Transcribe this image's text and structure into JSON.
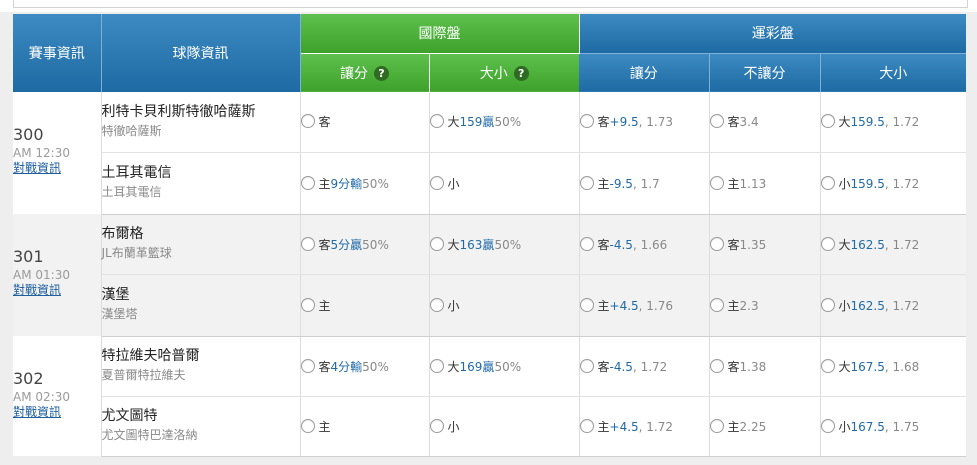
{
  "header": {
    "match_info": "賽事資訊",
    "team_info": "球隊資訊",
    "intl_market": "國際盤",
    "sports_lottery": "運彩盤",
    "intl_handicap": "讓分",
    "intl_total": "大小",
    "lottery_handicap": "讓分",
    "lottery_moneyline": "不讓分",
    "lottery_total": "大小",
    "help_symbol": "?"
  },
  "colors": {
    "intl_header": "#4cb23a",
    "lottery_header": "#2a78b4",
    "link": "#1e5fa0"
  },
  "icons": {
    "help": "question-circle-icon",
    "radio": "radio-circle"
  },
  "games": [
    {
      "number": "300",
      "time": "AM 12:30",
      "link": "對戰資訊",
      "away": {
        "name": "利特卡貝利斯特徹哈薩斯",
        "sub": "特徹哈薩斯",
        "intl_handicap": {
          "side": "客",
          "value": "",
          "result": ""
        },
        "intl_total": {
          "side": "大",
          "line": "159",
          "result": "贏",
          "pct": "50%"
        },
        "lot_handicap": {
          "side": "客",
          "line": "+9.5",
          "odds": "1.73"
        },
        "lot_ml": {
          "side": "客",
          "odds": "3.4"
        },
        "lot_total": {
          "side": "大",
          "line": "159.5",
          "odds": "1.72"
        }
      },
      "home": {
        "name": "土耳其電信",
        "sub": "土耳其電信",
        "intl_handicap": {
          "side": "主",
          "value": "9分",
          "result": "輸",
          "pct": "50%"
        },
        "intl_total": {
          "side": "小",
          "line": "",
          "result": "",
          "pct": ""
        },
        "lot_handicap": {
          "side": "主",
          "line": "-9.5",
          "odds": "1.7"
        },
        "lot_ml": {
          "side": "主",
          "odds": "1.13"
        },
        "lot_total": {
          "side": "小",
          "line": "159.5",
          "odds": "1.72"
        }
      }
    },
    {
      "number": "301",
      "time": "AM 01:30",
      "link": "對戰資訊",
      "away": {
        "name": "布爾格",
        "sub": "JL布蘭革籃球",
        "intl_handicap": {
          "side": "客",
          "value": "5分",
          "result": "贏",
          "pct": "50%"
        },
        "intl_total": {
          "side": "大",
          "line": "163",
          "result": "贏",
          "pct": "50%"
        },
        "lot_handicap": {
          "side": "客",
          "line": "-4.5",
          "odds": "1.66"
        },
        "lot_ml": {
          "side": "客",
          "odds": "1.35"
        },
        "lot_total": {
          "side": "大",
          "line": "162.5",
          "odds": "1.72"
        }
      },
      "home": {
        "name": "漢堡",
        "sub": "漢堡塔",
        "intl_handicap": {
          "side": "主",
          "value": "",
          "result": "",
          "pct": ""
        },
        "intl_total": {
          "side": "小",
          "line": "",
          "result": "",
          "pct": ""
        },
        "lot_handicap": {
          "side": "主",
          "line": "+4.5",
          "odds": "1.76"
        },
        "lot_ml": {
          "side": "主",
          "odds": "2.3"
        },
        "lot_total": {
          "side": "小",
          "line": "162.5",
          "odds": "1.72"
        }
      }
    },
    {
      "number": "302",
      "time": "AM 02:30",
      "link": "對戰資訊",
      "away": {
        "name": "特拉維夫哈普爾",
        "sub": "夏普爾特拉維夫",
        "intl_handicap": {
          "side": "客",
          "value": "4分",
          "result": "輸",
          "pct": "50%"
        },
        "intl_total": {
          "side": "大",
          "line": "169",
          "result": "贏",
          "pct": "50%"
        },
        "lot_handicap": {
          "side": "客",
          "line": "-4.5",
          "odds": "1.72"
        },
        "lot_ml": {
          "side": "客",
          "odds": "1.38"
        },
        "lot_total": {
          "side": "大",
          "line": "167.5",
          "odds": "1.68"
        }
      },
      "home": {
        "name": "尤文圖特",
        "sub": "尤文圖特巴達洛納",
        "intl_handicap": {
          "side": "主",
          "value": "",
          "result": "",
          "pct": ""
        },
        "intl_total": {
          "side": "小",
          "line": "",
          "result": "",
          "pct": ""
        },
        "lot_handicap": {
          "side": "主",
          "line": "+4.5",
          "odds": "1.72"
        },
        "lot_ml": {
          "side": "主",
          "odds": "2.25"
        },
        "lot_total": {
          "side": "小",
          "line": "167.5",
          "odds": "1.75"
        }
      }
    }
  ]
}
